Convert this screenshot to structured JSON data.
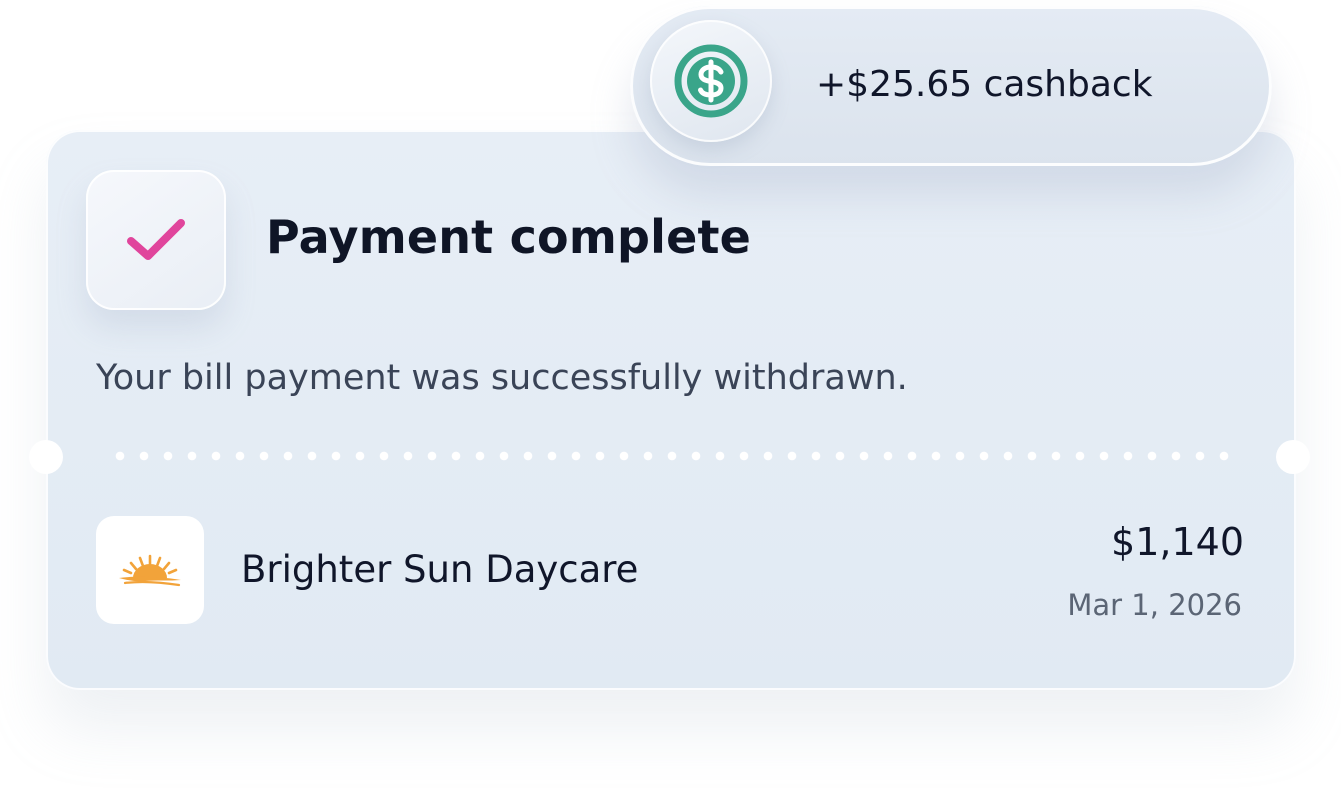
{
  "receipt": {
    "title": "Payment complete",
    "message": "Your bill payment was successfully withdrawn.",
    "status_icon": "check-icon",
    "status_color": "#e0459c"
  },
  "merchant": {
    "name": "Brighter Sun Daycare",
    "logo_icon": "sun-logo-icon",
    "logo_color": "#f2a33a",
    "amount": "$1,140",
    "date": "Mar 1, 2026"
  },
  "cashback": {
    "label": "+$25.65 cashback",
    "icon": "dollar-coin-icon",
    "icon_color": "#3aa58a"
  }
}
